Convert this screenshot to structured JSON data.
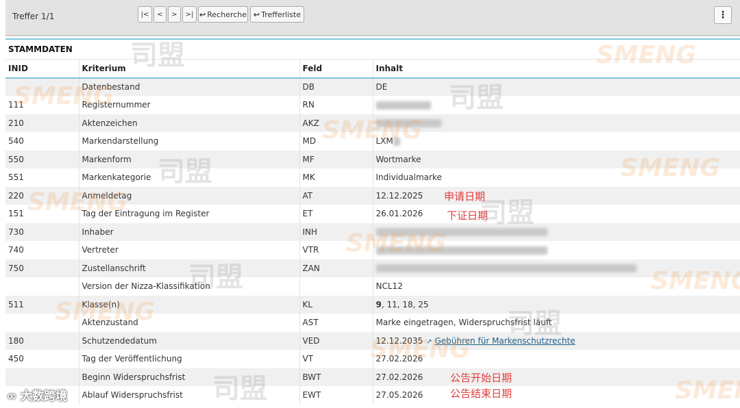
{
  "toolbar": {
    "hits": "Treffer 1/1",
    "first": "|<",
    "prev": "<",
    "next": ">",
    "last": ">|",
    "recherche": "Recherche",
    "trefferliste": "Trefferliste",
    "menu": "⋮"
  },
  "section": "STAMMDATEN",
  "columns": [
    "INID",
    "Kriterium",
    "Feld",
    "Inhalt"
  ],
  "rows": [
    {
      "inid": "",
      "kriterium": "Datenbestand",
      "feld": "DB",
      "inhalt": "DE"
    },
    {
      "inid": "111",
      "kriterium": "Registernummer",
      "feld": "RN",
      "inhalt": ""
    },
    {
      "inid": "210",
      "kriterium": "Aktenzeichen",
      "feld": "AKZ",
      "inhalt": ""
    },
    {
      "inid": "540",
      "kriterium": "Markendarstellung",
      "feld": "MD",
      "inhalt": "LXM"
    },
    {
      "inid": "550",
      "kriterium": "Markenform",
      "feld": "MF",
      "inhalt": "Wortmarke"
    },
    {
      "inid": "551",
      "kriterium": "Markenkategorie",
      "feld": "MK",
      "inhalt": "Individualmarke"
    },
    {
      "inid": "220",
      "kriterium": "Anmeldetag",
      "feld": "AT",
      "inhalt": "12.12.2025"
    },
    {
      "inid": "151",
      "kriterium": "Tag der Eintragung im Register",
      "feld": "ET",
      "inhalt": "26.01.2026"
    },
    {
      "inid": "730",
      "kriterium": "Inhaber",
      "feld": "INH",
      "inhalt": ""
    },
    {
      "inid": "740",
      "kriterium": "Vertreter",
      "feld": "VTR",
      "inhalt": ""
    },
    {
      "inid": "750",
      "kriterium": "Zustellanschrift",
      "feld": "ZAN",
      "inhalt": ""
    },
    {
      "inid": "",
      "kriterium": "Version der Nizza-Klassifikation",
      "feld": "",
      "inhalt": "NCL12"
    },
    {
      "inid": "511",
      "kriterium": "Klasse(n)",
      "feld": "KL",
      "inhalt_bold": "9",
      "inhalt": ", 11, 18, 25"
    },
    {
      "inid": "",
      "kriterium": "Aktenzustand",
      "feld": "AST",
      "inhalt": "Marke eingetragen, Widerspruchsfrist läuft"
    },
    {
      "inid": "180",
      "kriterium": "Schutzendedatum",
      "feld": "VED",
      "inhalt": "12.12.2035",
      "link": "Gebühren für Markenschutzrechte"
    },
    {
      "inid": "450",
      "kriterium": "Tag der Veröffentlichung",
      "feld": "VT",
      "inhalt": "27.02.2026"
    },
    {
      "inid": "",
      "kriterium": "Beginn Widerspruchsfrist",
      "feld": "BWT",
      "inhalt": "27.02.2026"
    },
    {
      "inid": "",
      "kriterium": "Ablauf Widerspruchsfrist",
      "feld": "EWT",
      "inhalt": "27.05.2026"
    }
  ],
  "notes": {
    "filing_date": "申请日期",
    "registration_date": "下证日期",
    "publication_start": "公告开始日期",
    "publication_end": "公告结束日期"
  },
  "watermarks": {
    "cn": "司盟",
    "en": "SMENG",
    "corner": "大数跨境"
  },
  "colors": {
    "accent_line": "#7bc4dc",
    "note_red": "#e23b3b",
    "link_blue": "#1d5f8c"
  }
}
